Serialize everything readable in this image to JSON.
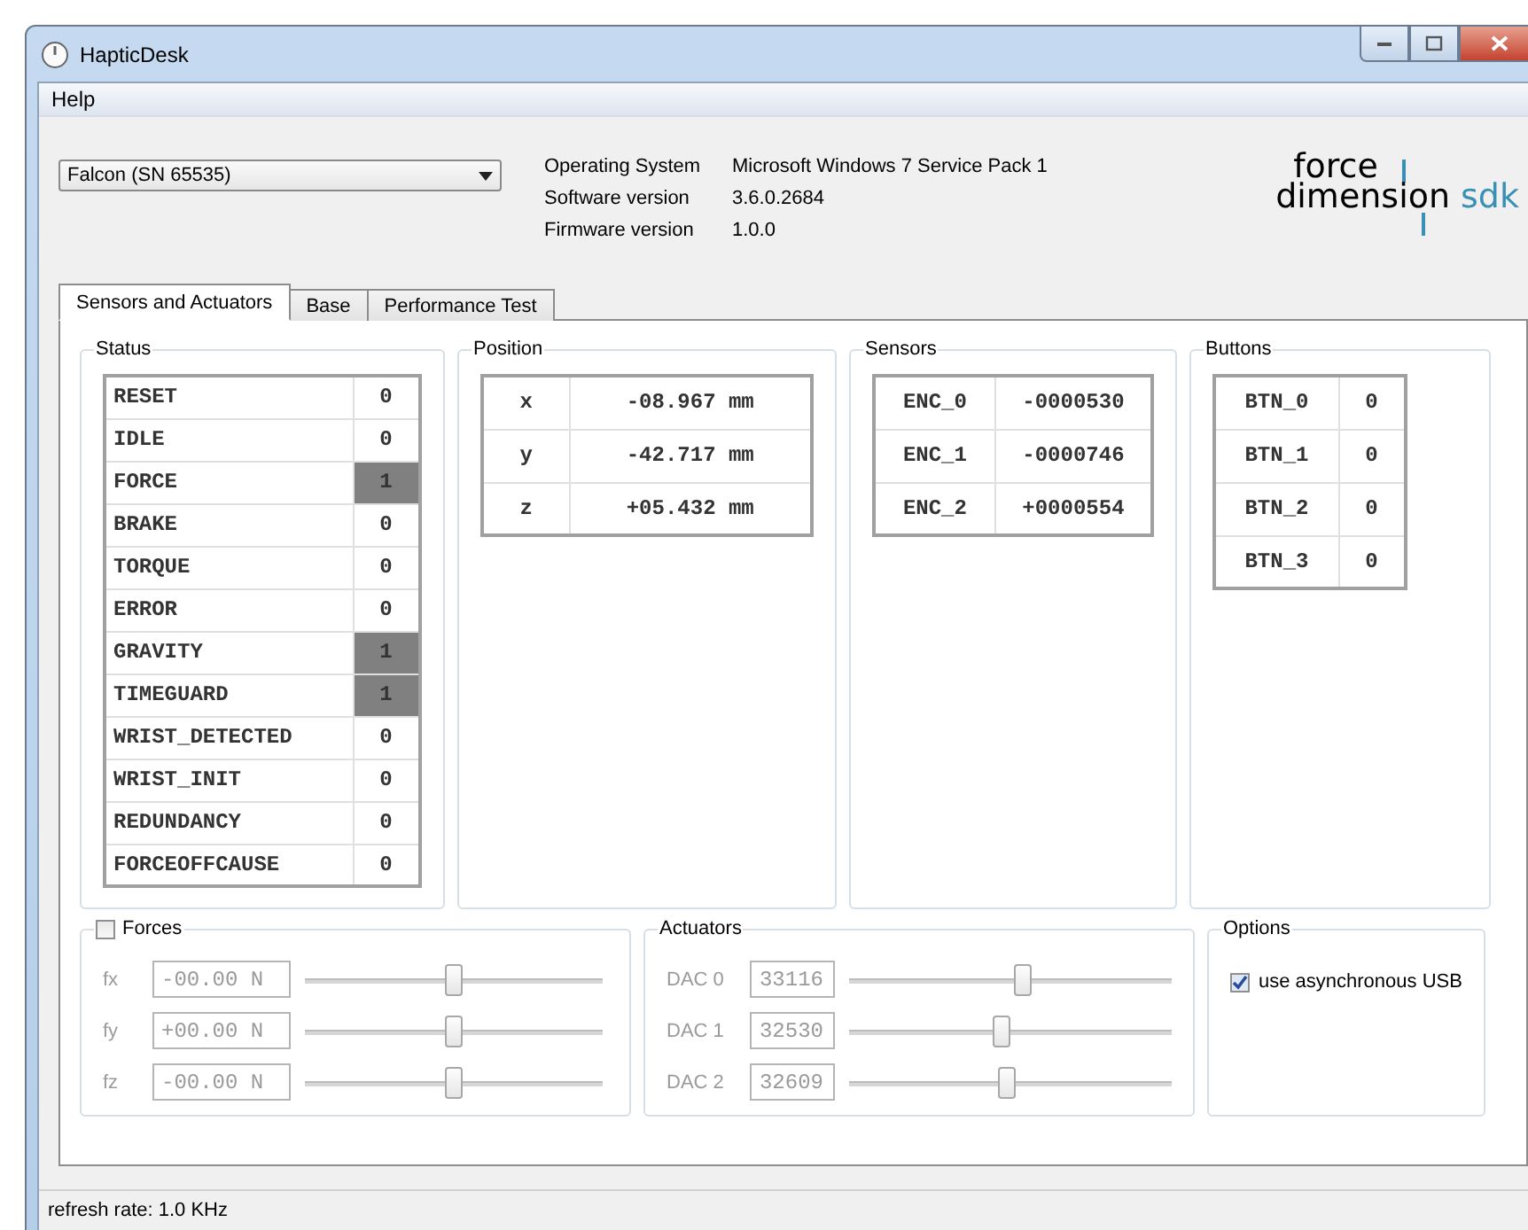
{
  "window": {
    "title": "HapticDesk"
  },
  "menu": [
    "Help"
  ],
  "device_select": {
    "value": "Falcon (SN 65535)"
  },
  "info": [
    {
      "label": "Operating System",
      "value": "Microsoft Windows 7 Service Pack 1"
    },
    {
      "label": "Software version",
      "value": "3.6.0.2684"
    },
    {
      "label": "Firmware version",
      "value": "1.0.0"
    }
  ],
  "logo": {
    "top": "force",
    "bottom": "dimension",
    "suffix": "sdk"
  },
  "tabs": [
    {
      "label": "Sensors and Actuators",
      "selected": true
    },
    {
      "label": "Base",
      "selected": false
    },
    {
      "label": "Performance Test",
      "selected": false
    }
  ],
  "status": {
    "title": "Status",
    "rows": [
      {
        "name": "RESET",
        "value": "0",
        "active": false
      },
      {
        "name": "IDLE",
        "value": "0",
        "active": false
      },
      {
        "name": "FORCE",
        "value": "1",
        "active": true
      },
      {
        "name": "BRAKE",
        "value": "0",
        "active": false
      },
      {
        "name": "TORQUE",
        "value": "0",
        "active": false
      },
      {
        "name": "ERROR",
        "value": "0",
        "active": false
      },
      {
        "name": "GRAVITY",
        "value": "1",
        "active": true
      },
      {
        "name": "TIMEGUARD",
        "value": "1",
        "active": true
      },
      {
        "name": "WRIST_DETECTED",
        "value": "0",
        "active": false
      },
      {
        "name": "WRIST_INIT",
        "value": "0",
        "active": false
      },
      {
        "name": "REDUNDANCY",
        "value": "0",
        "active": false
      },
      {
        "name": "FORCEOFFCAUSE",
        "value": "0",
        "active": false
      }
    ]
  },
  "position": {
    "title": "Position",
    "rows": [
      {
        "axis": "x",
        "value": "-08.967 mm"
      },
      {
        "axis": "y",
        "value": "-42.717 mm"
      },
      {
        "axis": "z",
        "value": "+05.432 mm"
      }
    ]
  },
  "sensors": {
    "title": "Sensors",
    "rows": [
      {
        "name": "ENC_0",
        "value": "-0000530"
      },
      {
        "name": "ENC_1",
        "value": "-0000746"
      },
      {
        "name": "ENC_2",
        "value": "+0000554"
      }
    ]
  },
  "buttons": {
    "title": "Buttons",
    "rows": [
      {
        "name": "BTN_0",
        "value": "0"
      },
      {
        "name": "BTN_1",
        "value": "0"
      },
      {
        "name": "BTN_2",
        "value": "0"
      },
      {
        "name": "BTN_3",
        "value": "0"
      }
    ]
  },
  "forces": {
    "title": "Forces",
    "checked": false,
    "rows": [
      {
        "label": "fx",
        "value": "-00.00 N",
        "level": 0.5
      },
      {
        "label": "fy",
        "value": "+00.00 N",
        "level": 0.5
      },
      {
        "label": "fz",
        "value": "-00.00 N",
        "level": 0.5
      }
    ]
  },
  "actuators": {
    "title": "Actuators",
    "disabled": true,
    "rows": [
      {
        "label": "DAC 0",
        "value": "33116",
        "level": 0.54
      },
      {
        "label": "DAC 1",
        "value": "32530",
        "level": 0.47
      },
      {
        "label": "DAC 2",
        "value": "32609",
        "level": 0.49
      }
    ]
  },
  "options": {
    "title": "Options",
    "items": [
      {
        "label": "use asynchronous USB",
        "checked": true
      }
    ]
  },
  "status_bar": "refresh rate: 1.0 KHz"
}
